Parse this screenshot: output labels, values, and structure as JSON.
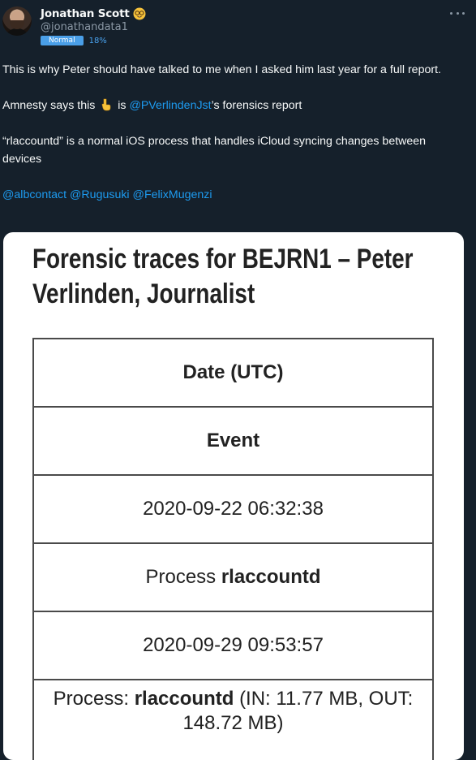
{
  "author": {
    "display_name": "Jonathan Scott",
    "handle": "@jonathandata1",
    "badge": "Normal",
    "percent": "18%"
  },
  "tweet": {
    "line1": "This is why Peter should have talked to me when I asked him last year for a full report.",
    "line2_before": "Amnesty says this",
    "line2_is": "is",
    "line2_mention": "@PVerlindenJst",
    "line2_after": "’s forensics report",
    "line3": "“rlaccountd” is a normal iOS process that handles iCloud syncing changes between devices",
    "mentions": [
      "@albcontact",
      "@Rugusuki",
      "@FelixMugenzi"
    ]
  },
  "document": {
    "title": "Forensic traces for BEJRN1 – Peter Verlinden, Journalist",
    "header_date": "Date (UTC)",
    "header_event": "Event",
    "row1_date": "2020-09-22 06:32:38",
    "row1_event_prefix": "Process",
    "row1_event_process": "rlaccountd",
    "row2_date": "2020-09-29 09:53:57",
    "row2_event_prefix": "Process:",
    "row2_event_process": "rlaccountd",
    "row2_event_suffix": "(IN: 11.77 MB, OUT: 148.72 MB)"
  },
  "icons": {
    "verified": "nerd-face-emoji-icon",
    "pointing": "pointing-down-emoji-icon",
    "more": "more-options-icon"
  },
  "colors": {
    "background": "#15202b",
    "link": "#1d9bf0",
    "badge": "#4a9fe8"
  }
}
